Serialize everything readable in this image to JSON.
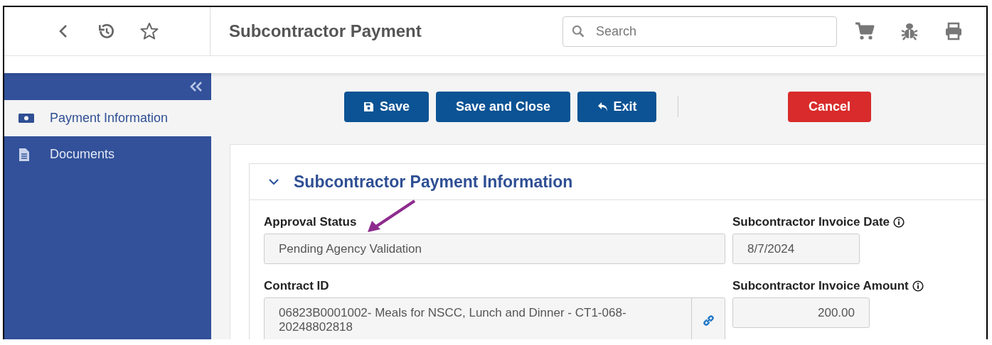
{
  "header": {
    "title": "Subcontractor Payment",
    "search": {
      "placeholder": "Search"
    }
  },
  "sidebar": {
    "items": [
      {
        "label": "Payment Information",
        "kind": "money",
        "selected": true
      },
      {
        "label": "Documents",
        "kind": "document",
        "selected": false
      }
    ]
  },
  "toolbar": {
    "buttons": [
      {
        "label": "Save",
        "kind": "save"
      },
      {
        "label": "Save and Close",
        "kind": "plain"
      },
      {
        "label": "Exit",
        "kind": "exit"
      },
      {
        "label": "Cancel",
        "kind": "danger"
      }
    ]
  },
  "section": {
    "title": "Subcontractor Payment Information",
    "expanded": true,
    "left_fields": [
      {
        "label": "Approval Status",
        "value": "Pending Agency Validation",
        "kind": "text",
        "info": false
      },
      {
        "label": "Contract ID",
        "value": "06823B0001002- Meals for NSCC, Lunch and Dinner - CT1-068-20248802818",
        "kind": "link",
        "info": false
      }
    ],
    "right_fields": [
      {
        "label": "Subcontractor Invoice Date",
        "value": "8/7/2024",
        "kind": "date",
        "info": true
      },
      {
        "label": "Subcontractor Invoice Amount",
        "value": "200.00",
        "kind": "amount",
        "info": true
      }
    ]
  }
}
